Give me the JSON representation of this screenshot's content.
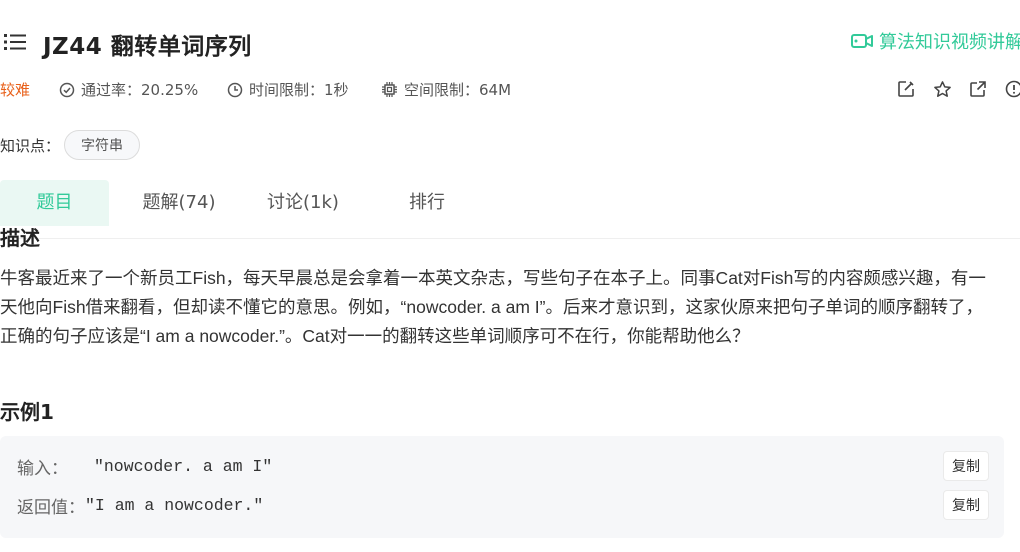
{
  "problem": {
    "title": "JZ44  翻转单词序列",
    "video_link_label": "算法知识视频讲解",
    "difficulty": "较难",
    "pass_rate": "通过率：20.25%",
    "time_limit": "时间限制：1秒",
    "space_limit": "空间限制：64M"
  },
  "knowledge": {
    "label": "知识点：",
    "tags": [
      "字符串"
    ]
  },
  "tabs": [
    {
      "label": "题目",
      "active": true
    },
    {
      "label": "题解(74)",
      "active": false
    },
    {
      "label": "讨论(1k)",
      "active": false
    },
    {
      "label": "排行",
      "active": false
    }
  ],
  "description": {
    "heading": "描述",
    "text": "牛客最近来了一个新员工Fish，每天早晨总是会拿着一本英文杂志，写些句子在本子上。同事Cat对Fish写的内容颇感兴趣，有一天他向Fish借来翻看，但却读不懂它的意思。例如，“nowcoder. a am I”。后来才意识到，这家伙原来把句子单词的顺序翻转了，正确的句子应该是“I am a nowcoder.”。Cat对一一的翻转这些单词顺序可不在行，你能帮助他么？"
  },
  "example": {
    "title": "示例1",
    "input_label": "输入：",
    "input_value": "\"nowcoder. a am I\"",
    "output_label": "返回值：",
    "output_value": "\"I am a nowcoder.\"",
    "copy_label": "复制"
  },
  "colors": {
    "accent": "#32ca99",
    "difficulty": "#e8601a"
  },
  "icons": [
    "menu-icon",
    "video-camera-icon",
    "check-circle-icon",
    "clock-icon",
    "chip-icon",
    "edit-icon",
    "star-icon",
    "share-icon",
    "info-icon"
  ]
}
